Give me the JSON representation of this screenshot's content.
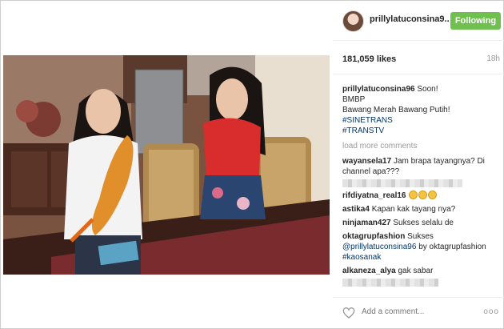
{
  "post": {
    "username": "prillylatuconsina9..",
    "follow_label": "Following",
    "likes": "181,059 likes",
    "time": "18h"
  },
  "caption": {
    "user": "prillylatuconsina96",
    "lines": [
      "Soon!",
      "BMBP",
      "Bawang Merah Bawang Putih!",
      "#SINETRANS",
      "#TRANSTV"
    ]
  },
  "load_more": "load more comments",
  "comments": [
    {
      "user": "wayansela17",
      "text": "Jam brapa tayangnya? Di channel apa???"
    },
    {
      "user": "rifdiyatna_real16",
      "text": ""
    },
    {
      "user": "astika4",
      "text": "Kapan kak tayang nya?"
    },
    {
      "user": "ninjaman427",
      "text": "Sukses selalu de"
    },
    {
      "user": "oktagrupfashion",
      "text": "Sukses",
      "mention": "@prillylatuconsina96",
      "text2": "by oktagrupfashion",
      "hashtag": "#kaosanak"
    },
    {
      "user": "alkaneza_alya",
      "text": "gak sabar"
    }
  ],
  "add_comment_placeholder": "Add a comment...",
  "more_label": "ooo",
  "colors": {
    "follow": "#70c050",
    "link": "#003569"
  },
  "icons": [
    "heart-icon",
    "more-icon"
  ]
}
